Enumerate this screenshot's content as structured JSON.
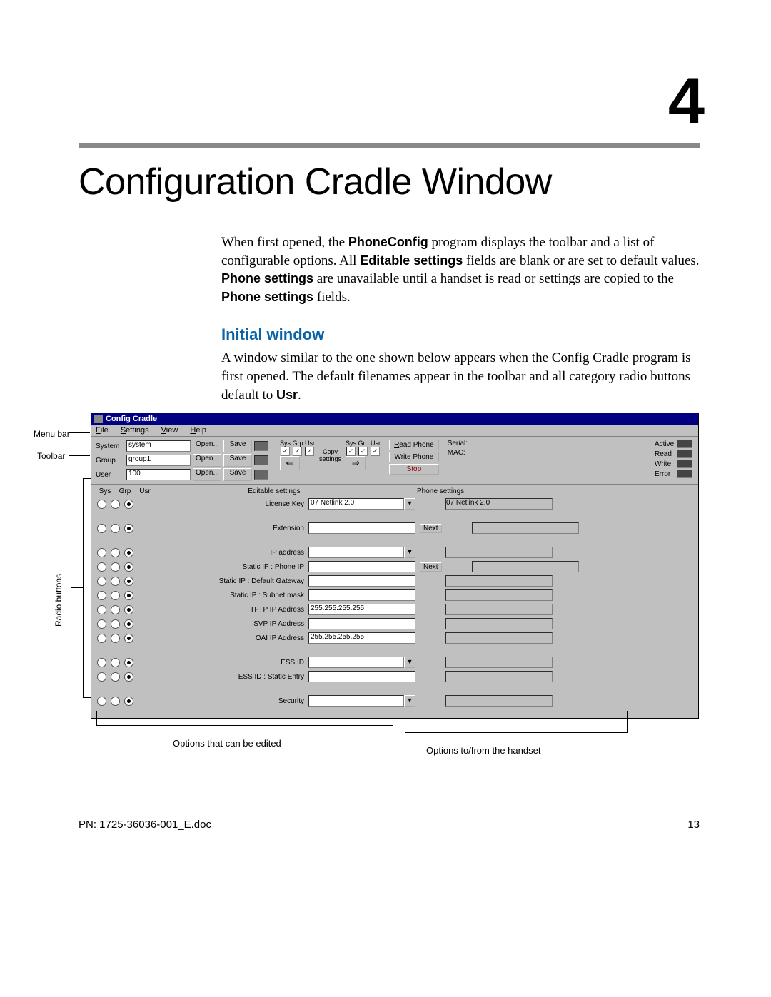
{
  "chapter_number": "4",
  "page_title": "Configuration Cradle Window",
  "para1_a": "When first opened, the ",
  "para1_b": "PhoneConfig",
  "para1_c": " program displays the toolbar and a list of configurable options. All ",
  "para1_d": "Editable settings",
  "para1_e": " fields are blank or are set to default values. ",
  "para1_f": "Phone settings",
  "para1_g": " are unavailable until a handset is read or settings are copied to the ",
  "para1_h": "Phone settings",
  "para1_i": " fields.",
  "subhead": "Initial window",
  "para2_a": "A window similar to the one shown below appears when the Config Cradle program is first opened. The default filenames appear in the toolbar and all category radio buttons default to ",
  "para2_b": "Usr",
  "para2_c": ".",
  "callouts": {
    "menu_bar": "Menu bar",
    "toolbar": "Toolbar",
    "radio_buttons": "Radio buttons",
    "editable": "Options that can be edited",
    "handset": "Options to/from the handset"
  },
  "win": {
    "title": "Config Cradle",
    "menu": {
      "file": "File",
      "settings": "Settings",
      "view": "View",
      "help": "Help"
    },
    "toolbar": {
      "system_label": "System",
      "system_value": "system",
      "group_label": "Group",
      "group_value": "group1",
      "user_label": "User",
      "user_value": "100",
      "open": "Open...",
      "save": "Save",
      "sgu": "Sys Grp Usr",
      "copy_label": "Copy",
      "settings_label": "settings",
      "read_phone": "Read Phone",
      "write_phone": "Write Phone",
      "stop": "Stop",
      "serial": "Serial:",
      "mac": "MAC:",
      "active": "Active",
      "read": "Read",
      "write": "Write",
      "error": "Error"
    },
    "cols": {
      "sys": "Sys",
      "grp": "Grp",
      "usr": "Usr",
      "editable": "Editable settings",
      "phone": "Phone settings"
    },
    "rows": [
      {
        "label": "License Key",
        "value": "07 Netlink 2.0",
        "dropdown": true,
        "next": false,
        "phone": "07 Netlink 2.0"
      },
      {
        "label": "Extension",
        "value": "",
        "dropdown": false,
        "next": true,
        "phone": ""
      },
      {
        "label": "IP address",
        "value": "",
        "dropdown": true,
        "next": false,
        "phone": ""
      },
      {
        "label": "Static IP : Phone IP",
        "value": "",
        "dropdown": false,
        "next": true,
        "phone": ""
      },
      {
        "label": "Static IP : Default Gateway",
        "value": "",
        "dropdown": false,
        "next": false,
        "phone": ""
      },
      {
        "label": "Static IP : Subnet mask",
        "value": "",
        "dropdown": false,
        "next": false,
        "phone": ""
      },
      {
        "label": "TFTP IP Address",
        "value": "255.255.255.255",
        "dropdown": false,
        "next": false,
        "phone": ""
      },
      {
        "label": "SVP IP Address",
        "value": "",
        "dropdown": false,
        "next": false,
        "phone": ""
      },
      {
        "label": "OAI IP Address",
        "value": "255.255.255.255",
        "dropdown": false,
        "next": false,
        "phone": ""
      },
      {
        "label": "ESS ID",
        "value": "",
        "dropdown": true,
        "next": false,
        "phone": ""
      },
      {
        "label": "ESS ID : Static Entry",
        "value": "",
        "dropdown": false,
        "next": false,
        "phone": ""
      },
      {
        "label": "Security",
        "value": "",
        "dropdown": true,
        "next": false,
        "phone": ""
      }
    ],
    "next_label": "Next"
  },
  "footer": {
    "pn": "PN: 1725-36036-001_E.doc",
    "page": "13"
  }
}
